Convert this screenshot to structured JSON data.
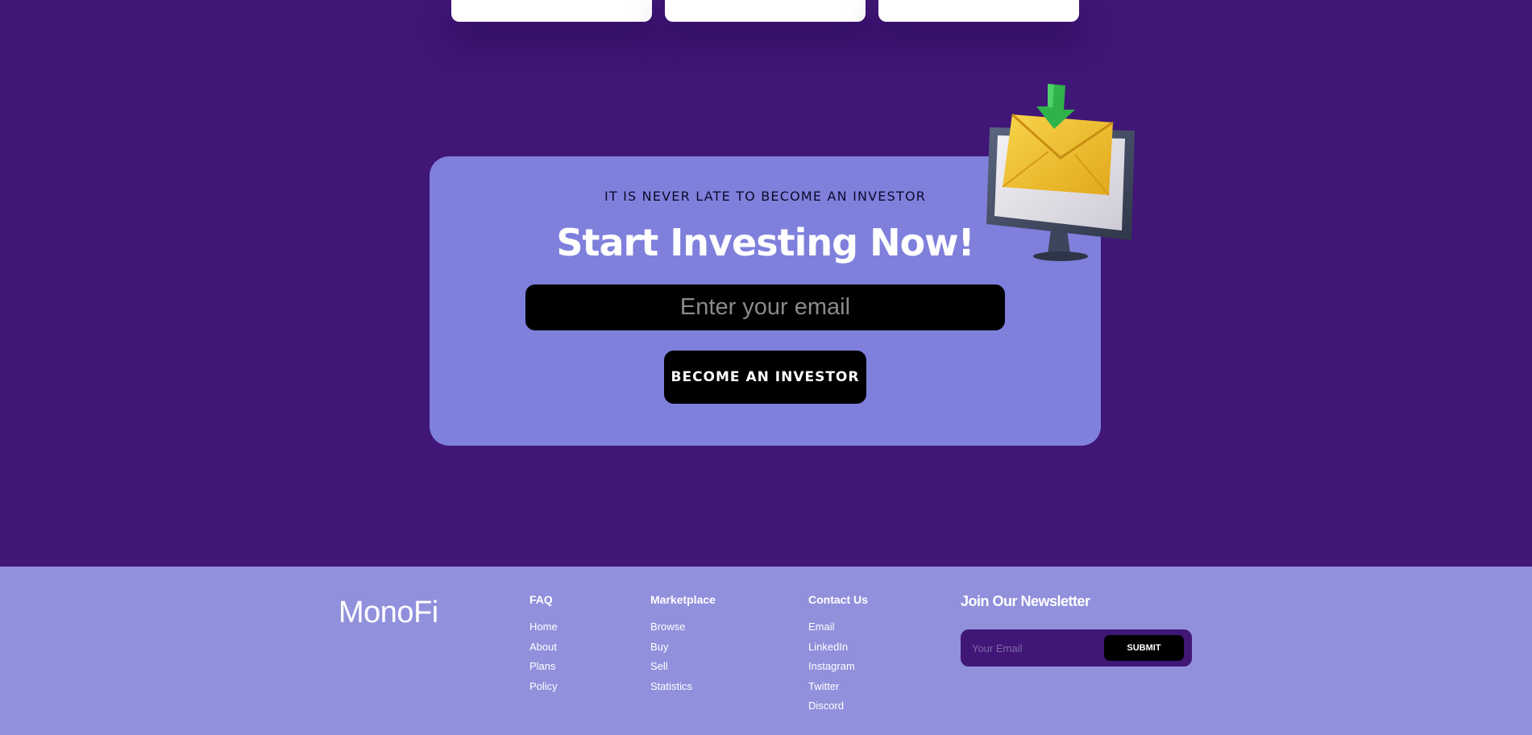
{
  "cta": {
    "eyebrow": "IT IS NEVER LATE TO BECOME AN INVESTOR",
    "title": "Start Investing Now!",
    "email_placeholder": "Enter your email",
    "button_label": "BECOME AN INVESTOR"
  },
  "footer": {
    "logo_part1": "Mono",
    "logo_part2": "Fi",
    "columns": [
      {
        "heading": "FAQ",
        "items": [
          "Home",
          "About",
          "Plans",
          "Policy"
        ]
      },
      {
        "heading": "Marketplace",
        "items": [
          "Browse",
          "Buy",
          "Sell",
          "Statistics"
        ]
      },
      {
        "heading": "Contact Us",
        "items": [
          "Email",
          "LinkedIn",
          "Instagram",
          "Twitter",
          "Discord"
        ]
      }
    ],
    "newsletter": {
      "heading": "Join Our Newsletter",
      "email_placeholder": "Your Email",
      "submit_label": "SUBMIT"
    }
  },
  "colors": {
    "page_background": "#401677",
    "cta_panel": "#7f80dc",
    "footer_background": "#9190dc",
    "button": "#000000"
  },
  "icons": {
    "illustration": "monitor-envelope-download-icon"
  }
}
